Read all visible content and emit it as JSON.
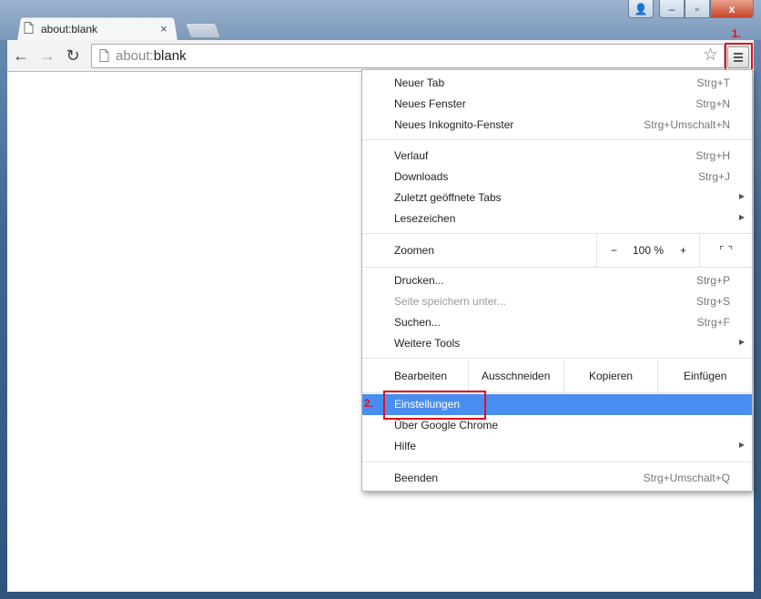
{
  "tab": {
    "title": "about:blank",
    "close": "×"
  },
  "window_controls": {
    "user": "👤",
    "minimize": "‒",
    "maximize": "▫",
    "close": "x"
  },
  "nav": {
    "back": "←",
    "forward": "→",
    "reload": "↻"
  },
  "omnibox": {
    "scheme": "about:",
    "rest": "blank",
    "star": "☆"
  },
  "annotations": {
    "step1": "1.",
    "step2": "2.",
    "highlight_color": "#e0101e"
  },
  "menu": {
    "group1": [
      {
        "label": "Neuer Tab",
        "shortcut": "Strg+T"
      },
      {
        "label": "Neues Fenster",
        "shortcut": "Strg+N"
      },
      {
        "label": "Neues Inkognito-Fenster",
        "shortcut": "Strg+Umschalt+N"
      }
    ],
    "group2": [
      {
        "label": "Verlauf",
        "shortcut": "Strg+H"
      },
      {
        "label": "Downloads",
        "shortcut": "Strg+J"
      },
      {
        "label": "Zuletzt geöffnete Tabs",
        "submenu": "▶"
      },
      {
        "label": "Lesezeichen",
        "submenu": "▶"
      }
    ],
    "zoom": {
      "label": "Zoomen",
      "minus": "−",
      "value": "100 %",
      "plus": "+",
      "fullscreen": "⌜⌝"
    },
    "group3": [
      {
        "label": "Drucken...",
        "shortcut": "Strg+P"
      },
      {
        "label": "Seite speichern unter...",
        "shortcut": "Strg+S",
        "disabled": true
      },
      {
        "label": "Suchen...",
        "shortcut": "Strg+F"
      },
      {
        "label": "Weitere Tools",
        "submenu": "▶"
      }
    ],
    "edit": {
      "label": "Bearbeiten",
      "cut": "Ausschneiden",
      "copy": "Kopieren",
      "paste": "Einfügen"
    },
    "group4": [
      {
        "label": "Einstellungen",
        "selected": true
      },
      {
        "label": "Über Google Chrome"
      },
      {
        "label": "Hilfe",
        "submenu": "▶"
      }
    ],
    "quit": {
      "label": "Beenden",
      "shortcut": "Strg+Umschalt+Q"
    },
    "selected_color": "#4a8df0"
  }
}
